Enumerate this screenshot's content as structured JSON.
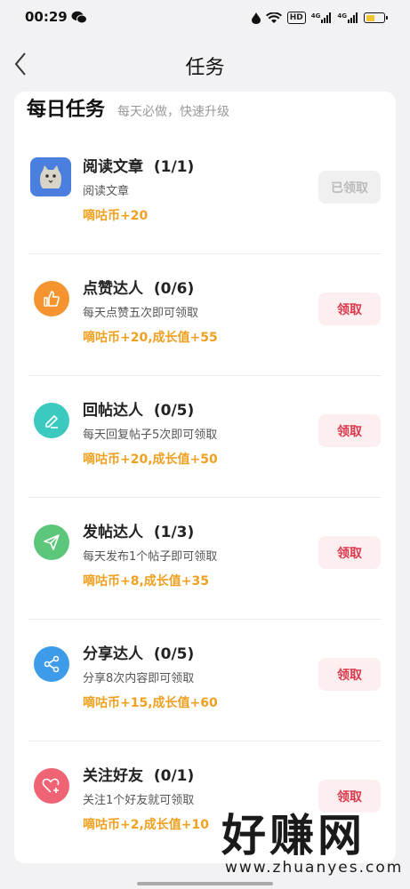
{
  "status_bar": {
    "time": "00:29",
    "hd": "HD",
    "net1": "4G",
    "net2": "4G",
    "battery_level": 0.5
  },
  "header": {
    "title": "任务",
    "back_icon": "chevron-left-icon"
  },
  "daily": {
    "title": "每日任务",
    "subtitle": "每天必做，快速升级",
    "tasks": [
      {
        "title": "阅读文章",
        "progress": "(1/1)",
        "desc": "阅读文章",
        "reward": "嘀咕币+20",
        "button": "已领取",
        "claimed": true,
        "icon": "cat-avatar-icon",
        "color": "#4a7fe0"
      },
      {
        "title": "点赞达人",
        "progress": "(0/6)",
        "desc": "每天点赞五次即可领取",
        "reward": "嘀咕币+20,成长值+55",
        "button": "领取",
        "claimed": false,
        "icon": "thumbs-up-icon",
        "color": "#f5942e"
      },
      {
        "title": "回帖达人",
        "progress": "(0/5)",
        "desc": "每天回复帖子5次即可领取",
        "reward": "嘀咕币+20,成长值+50",
        "button": "领取",
        "claimed": false,
        "icon": "pencil-icon",
        "color": "#3cc9c0"
      },
      {
        "title": "发帖达人",
        "progress": "(1/3)",
        "desc": "每天发布1个帖子即可领取",
        "reward": "嘀咕币+8,成长值+35",
        "button": "领取",
        "claimed": false,
        "icon": "paper-plane-icon",
        "color": "#5cc77a"
      },
      {
        "title": "分享达人",
        "progress": "(0/5)",
        "desc": "分享8次内容即可领取",
        "reward": "嘀咕币+15,成长值+60",
        "button": "领取",
        "claimed": false,
        "icon": "share-icon",
        "color": "#3d9be9"
      },
      {
        "title": "关注好友",
        "progress": "(0/1)",
        "desc": "关注1个好友就可领取",
        "reward": "嘀咕币+2,成长值+10",
        "button": "领取",
        "claimed": false,
        "icon": "heart-plus-icon",
        "color": "#ef6474"
      }
    ]
  },
  "watermark": {
    "text": "好赚网",
    "url": "www.zhuanyes.com"
  }
}
